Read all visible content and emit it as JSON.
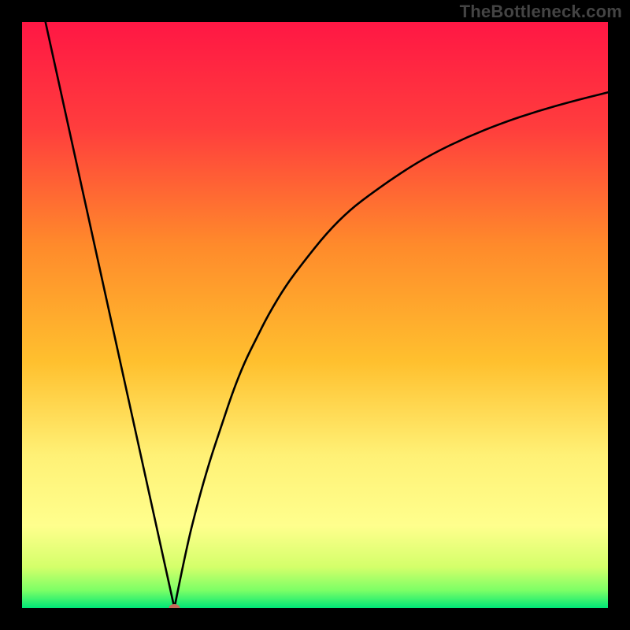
{
  "watermark": "TheBottleneck.com",
  "chart_data": {
    "type": "line",
    "title": "",
    "xlabel": "",
    "ylabel": "",
    "xlim": [
      0,
      100
    ],
    "ylim": [
      0,
      100
    ],
    "min_point_x": 26,
    "series": [
      {
        "name": "left-arm",
        "x": [
          4,
          26
        ],
        "y": [
          100,
          0
        ]
      },
      {
        "name": "right-arm",
        "x": [
          26,
          28,
          30,
          32,
          34,
          36,
          38,
          40,
          42,
          45,
          48,
          52,
          56,
          60,
          65,
          70,
          76,
          82,
          88,
          94,
          100
        ],
        "y": [
          0,
          10,
          18,
          25,
          31,
          37,
          42,
          46,
          50,
          55,
          59,
          64,
          68,
          71,
          74.5,
          77.5,
          80.4,
          82.8,
          84.8,
          86.5,
          88
        ]
      }
    ],
    "gradient_stops": [
      {
        "offset": 0,
        "color": "#ff1744"
      },
      {
        "offset": 18,
        "color": "#ff3d3d"
      },
      {
        "offset": 38,
        "color": "#ff8a2b"
      },
      {
        "offset": 58,
        "color": "#ffc02e"
      },
      {
        "offset": 74,
        "color": "#fff176"
      },
      {
        "offset": 86,
        "color": "#ffff8d"
      },
      {
        "offset": 93,
        "color": "#d4ff6a"
      },
      {
        "offset": 97,
        "color": "#7cff66"
      },
      {
        "offset": 100,
        "color": "#00e676"
      }
    ],
    "marker": {
      "x": 26,
      "y": 0,
      "color": "#c46a5a",
      "rx": 7,
      "ry": 5
    }
  }
}
